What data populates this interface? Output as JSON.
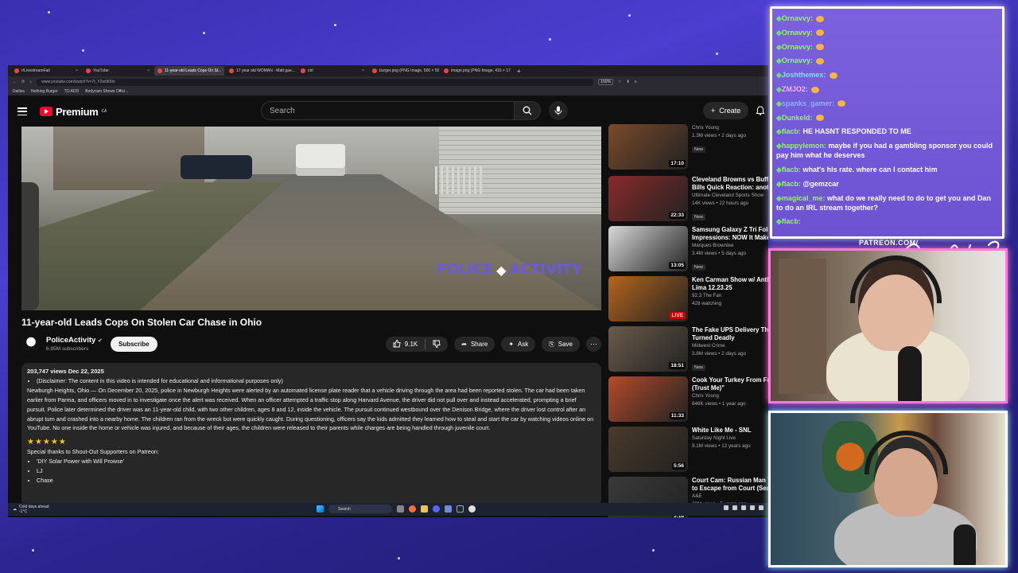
{
  "browser": {
    "tabs": [
      {
        "label": "r/LivestreamFail",
        "active": false
      },
      {
        "label": "YouTube",
        "active": false
      },
      {
        "label": "11-year-old Leads Cops On St...",
        "active": true
      },
      {
        "label": "17 year old WOMAN - Matt gae...",
        "active": false
      },
      {
        "label": "ctrl",
        "active": false
      },
      {
        "label": "burger.png (PNG Image, 500 × 500...",
        "active": false
      },
      {
        "label": "image.png (PNG Image, 415 × 17...",
        "active": false
      }
    ],
    "url": "www.youtube.com/watch?v=7t_Y2w0t09o",
    "zoom": "150%",
    "bookmarks": [
      "Dailies",
      "Nothing Burger",
      "TO ADD",
      "Bodycam Shows Offici..."
    ]
  },
  "youtube": {
    "logo_text": "Premium",
    "region": "CA",
    "search_placeholder": "Search",
    "create_label": "Create"
  },
  "video": {
    "overlay_logo_left": "POLICE",
    "overlay_logo_right": "ACTIVITY",
    "title": "11-year-old Leads Cops On Stolen Car Chase in Ohio",
    "channel": "PoliceActivity",
    "subscribers": "6.85M subscribers",
    "subscribe_label": "Subscribe",
    "likes": "9.1K",
    "share_label": "Share",
    "ask_label": "Ask",
    "save_label": "Save",
    "views_date": "203,747 views  Dec 22, 2025",
    "disclaimer": "(Disclaimer: The content in this video is intended for educational and informational purposes only)",
    "description": "Newburgh Heights, Ohio — On December 20, 2025, police in Newburgh Heights were alerted by an automated license plate reader that a vehicle driving through the area had been reported stolen. The car had been taken earlier from Parma, and officers moved in to investigate once the alert was received. When an officer attempted a traffic stop along Harvard Avenue, the driver did not pull over and instead accelerated, prompting a brief pursuit. Police later determined the driver was an 11-year-old child, with two other children, ages 8 and 12, inside the vehicle. The pursuit continued westbound over the Denison Bridge, where the driver lost control after an abrupt turn and crashed into a nearby home. The children ran from the wreck but were quickly caught. During questioning, officers say the kids admitted they learned how to steal and start the car by watching videos online on YouTube. No one inside the home or vehicle was injured, and because of their ages, the children were released to their parents while charges are being handled through juvenile court.",
    "stars": "★★★★★",
    "thanks": "Special thanks to Shout-Out Supporters on Patreon:",
    "supporters": [
      "'DIY Solar Power with Will Prowse'",
      "LJ",
      "Chase"
    ]
  },
  "suggestions": [
    {
      "title": "",
      "channel": "Chris Young",
      "meta": "1.3M views • 2 days ago",
      "badge": "New",
      "duration": "17:10",
      "color": "#7a4a2a"
    },
    {
      "title": "Cleveland Browns vs Buffalo",
      "title2": "Bills Quick Reaction: anoth",
      "channel": "Ultimate Cleveland Sports Show",
      "meta": "14K views • 22 hours ago",
      "badge": "New",
      "duration": "22:33",
      "color": "#8a2a2a"
    },
    {
      "title": "Samsung Galaxy Z Tri Fold",
      "title2": "Impressions: NOW It Makes",
      "channel": "Marques Brownlee",
      "meta": "3.4M views • 5 days ago",
      "badge": "New",
      "duration": "13:05",
      "color": "#d8d8d8"
    },
    {
      "title": "Ken Carman Show w/ Anthony",
      "title2": "Lima 12.23.25",
      "channel": "92.3 The Fan",
      "meta": "428 watching",
      "badge": "",
      "duration": "LIVE",
      "color": "#b5651d"
    },
    {
      "title": "The Fake UPS Delivery That",
      "title2": "Turned Deadly",
      "channel": "Midwest Crime",
      "meta": "3.8M views • 2 days ago",
      "badge": "New",
      "duration": "18:51",
      "color": "#6a5a4a"
    },
    {
      "title": "Cook Your Turkey From Frozen",
      "title2": "(Trust Me)\"",
      "channel": "Chris Young",
      "meta": "846K views • 1 year ago",
      "badge": "",
      "duration": "11:33",
      "color": "#b44a2a"
    },
    {
      "title": "White Like Me - SNL",
      "title2": "",
      "channel": "Saturday Night Live",
      "meta": "9.1M views • 12 years ago",
      "badge": "",
      "duration": "5:56",
      "color": "#4a3a2a"
    },
    {
      "title": "Court Cam: Russian Man Tries",
      "title2": "to Escape from Court (Season",
      "channel": "A&E",
      "meta": "30M views • 5 years ago",
      "badge": "",
      "duration": "3:18",
      "color": "#3a3a3a"
    }
  ],
  "taskbar": {
    "weather": "Cold days ahead",
    "temp": "-1°C",
    "search": "Search"
  },
  "chat": [
    {
      "user": "Ornavvy:",
      "text": "",
      "emote": true,
      "cls": ""
    },
    {
      "user": "Ornavvy:",
      "text": "",
      "emote": true,
      "cls": ""
    },
    {
      "user": "Ornavvy:",
      "text": "",
      "emote": true,
      "cls": ""
    },
    {
      "user": "Ornavvy:",
      "text": "",
      "emote": true,
      "cls": ""
    },
    {
      "user": "Joshthemex:",
      "text": "",
      "emote": true,
      "cls": "b"
    },
    {
      "user": "ZMJO2:",
      "text": "",
      "emote": true,
      "cls": "p"
    },
    {
      "user": "spanks_gamer:",
      "text": "",
      "emote": true,
      "cls": "s"
    },
    {
      "user": "Dunkeld:",
      "text": "",
      "emote": true,
      "cls": ""
    },
    {
      "user": "flacb:",
      "text": "HE HASNT RESPONDED TO ME",
      "emote": false,
      "cls": ""
    },
    {
      "user": "happylemon:",
      "text": "maybe if you had a gambling sponsor you could pay him what he deserves",
      "emote": false,
      "cls": ""
    },
    {
      "user": "flacb:",
      "text": "what's his rate. where can I contact him",
      "emote": false,
      "cls": ""
    },
    {
      "user": "flacb:",
      "text": "@gemzcar",
      "emote": false,
      "cls": ""
    },
    {
      "user": "magical_me:",
      "text": "what do we really need to do to get you and Dan to do an IRL stream together?",
      "emote": false,
      "cls": ""
    },
    {
      "user": "flacb:",
      "text": "",
      "emote": false,
      "cls": ""
    }
  ],
  "overlay": {
    "patreon": "PATREON.COM/",
    "signature": "Anything Else?"
  }
}
